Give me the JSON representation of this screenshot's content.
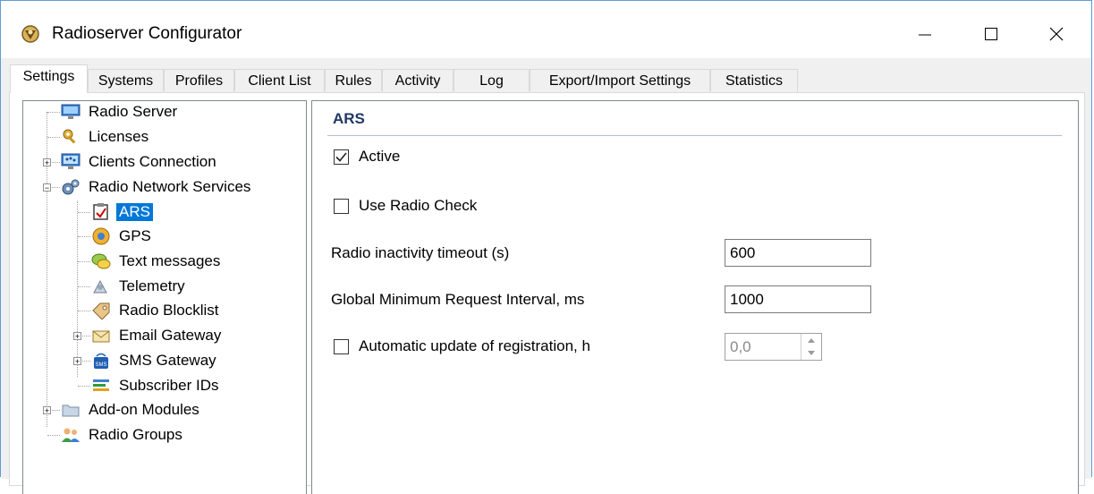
{
  "window": {
    "title": "Radioserver Configurator",
    "minimize_symbol": "—",
    "maximize_symbol": "☐",
    "close_symbol": "✕"
  },
  "tabs": [
    {
      "label": "Settings",
      "active": true
    },
    {
      "label": "Systems"
    },
    {
      "label": "Profiles"
    },
    {
      "label": "Client List"
    },
    {
      "label": "Rules"
    },
    {
      "label": "Activity"
    },
    {
      "label": "Log"
    },
    {
      "label": "Export/Import Settings"
    },
    {
      "label": "Statistics"
    }
  ],
  "tree": {
    "items": [
      {
        "label": "Radio Server",
        "icon": "monitor-icon"
      },
      {
        "label": "Licenses",
        "icon": "key-icon"
      },
      {
        "label": "Clients Connection",
        "icon": "network-icon",
        "expander": "+"
      },
      {
        "label": "Radio Network Services",
        "icon": "gears-icon",
        "expander": "−"
      },
      {
        "label": "ARS",
        "icon": "checkbox-icon",
        "selected": true
      },
      {
        "label": "GPS",
        "icon": "gps-icon"
      },
      {
        "label": "Text messages",
        "icon": "messages-icon"
      },
      {
        "label": "Telemetry",
        "icon": "telemetry-icon"
      },
      {
        "label": "Radio Blocklist",
        "icon": "tag-icon"
      },
      {
        "label": "Email Gateway",
        "icon": "email-icon",
        "expander": "+"
      },
      {
        "label": "SMS Gateway",
        "icon": "sms-icon",
        "expander": "+"
      },
      {
        "label": "Subscriber IDs",
        "icon": "subscriber-icon"
      },
      {
        "label": "Add-on Modules",
        "icon": "folder-icon",
        "expander": "+"
      },
      {
        "label": "Radio Groups",
        "icon": "users-icon"
      }
    ]
  },
  "panel": {
    "title": "ARS",
    "active_label": "Active",
    "active_checked": true,
    "use_radio_check_label": "Use Radio Check",
    "use_radio_check_checked": false,
    "inactivity_label": "Radio inactivity timeout (s)",
    "inactivity_value": "600",
    "min_request_label": "Global Minimum Request Interval, ms",
    "min_request_value": "1000",
    "auto_update_label": "Automatic update of registration, h",
    "auto_update_checked": false,
    "auto_update_value": "0,0"
  },
  "colors": {
    "selection": "#0078d7",
    "section_title": "#1f3864",
    "window_border": "#5f9bd6"
  }
}
